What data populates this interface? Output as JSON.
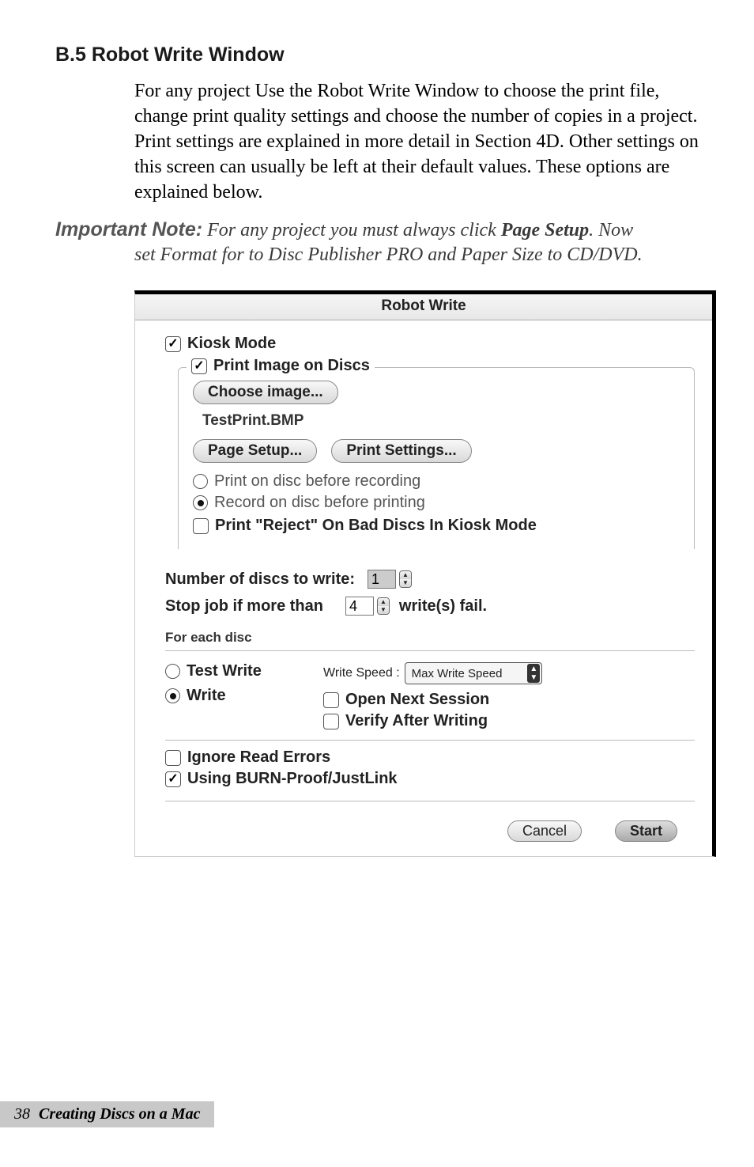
{
  "heading": "B.5 Robot Write Window",
  "paragraph": "For any project Use the Robot Write Window to choose the print file, change print quality settings and choose the number of copies in a project. Print settings are explained in more detail in Section 4D. Other settings on this screen can usually be left at their default values. These options are explained below.",
  "note": {
    "prefix": "Important Note:",
    "line1": " For any project you must always click ",
    "strong1": "Page Setup",
    "line1_tail": ". Now",
    "line2": "set Format for to Disc Publisher PRO and Paper Size to CD/DVD."
  },
  "dialog": {
    "title": "Robot Write",
    "kiosk": "Kiosk Mode",
    "print_image": "Print Image on Discs",
    "choose_image": "Choose image...",
    "filename": "TestPrint.BMP",
    "page_setup": "Page Setup...",
    "print_settings": "Print Settings...",
    "print_before": "Print on disc before recording",
    "record_before": "Record on disc before printing",
    "print_reject": "Print \"Reject\" On Bad Discs In Kiosk Mode",
    "num_discs_label": "Number of discs to write:",
    "num_discs": "1",
    "stop_label_a": "Stop job if more than",
    "stop_value": "4",
    "stop_label_b": "write(s) fail.",
    "for_each": "For each disc",
    "test_write": "Test Write",
    "write": "Write",
    "write_speed_label": "Write Speed :",
    "write_speed_value": "Max Write Speed",
    "open_next": "Open Next Session",
    "verify_after": "Verify After Writing",
    "ignore_read": "Ignore Read Errors",
    "burn_proof": "Using BURN-Proof/JustLink",
    "cancel": "Cancel",
    "start": "Start"
  },
  "footer": {
    "page": "38",
    "chapter": "Creating Discs on a Mac"
  }
}
